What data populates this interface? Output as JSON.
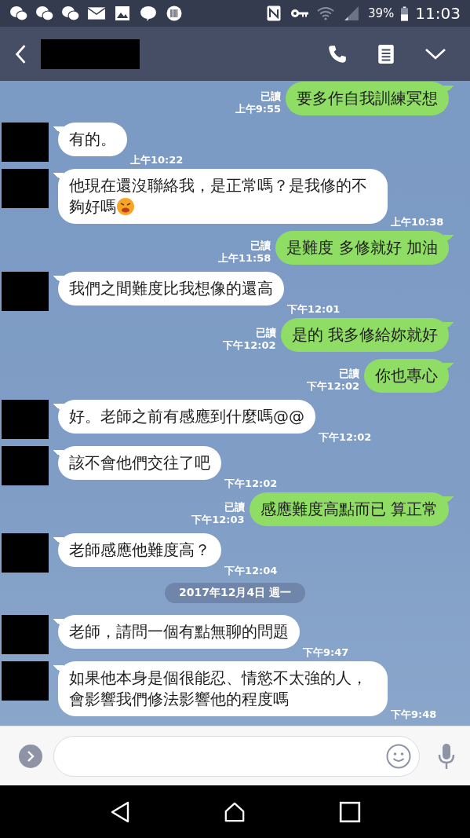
{
  "status_bar": {
    "battery": "39%",
    "time": "11:03"
  },
  "messages": [
    {
      "kind": "sent",
      "text": "要多作自我訓練冥想",
      "read": "已讀",
      "time": "上午9:55",
      "emoji": false
    },
    {
      "kind": "received",
      "text": "有的。",
      "time": "上午10:22",
      "emoji": false
    },
    {
      "kind": "received",
      "text": "他現在還沒聯絡我，是正常嗎？是我修的不夠好嗎",
      "time": "上午10:38",
      "emoji": true
    },
    {
      "kind": "sent",
      "text": "是難度  多修就好  加油",
      "read": "已讀",
      "time": "上午11:58",
      "emoji": false
    },
    {
      "kind": "received",
      "text": "我們之間難度比我想像的還高",
      "time": "下午12:01",
      "emoji": false
    },
    {
      "kind": "sent",
      "text": "是的  我多修給妳就好",
      "read": "已讀",
      "time": "下午12:02",
      "emoji": false
    },
    {
      "kind": "sent",
      "text": "你也專心",
      "read": "已讀",
      "time": "下午12:02",
      "emoji": false
    },
    {
      "kind": "received",
      "text": "好。老師之前有感應到什麼嗎@@",
      "time": "下午12:02",
      "emoji": false
    },
    {
      "kind": "received",
      "text": "該不會他們交往了吧",
      "time": "下午12:02",
      "emoji": false
    },
    {
      "kind": "sent",
      "text": "感應難度高點而已  算正常",
      "read": "已讀",
      "time": "下午12:03",
      "emoji": false
    },
    {
      "kind": "received",
      "text": "老師感應他難度高？",
      "time": "下午12:04",
      "emoji": false
    },
    {
      "kind": "date",
      "text": "2017年12月4日 週一"
    },
    {
      "kind": "received",
      "text": "老師，請問一個有點無聊的問題",
      "time": "下午9:47",
      "emoji": false
    },
    {
      "kind": "received",
      "text": "如果他本身是個很能忍、情慾不太強的人，會影響我們修法影響他的程度嗎",
      "time": "下午9:48",
      "emoji": false
    }
  ]
}
